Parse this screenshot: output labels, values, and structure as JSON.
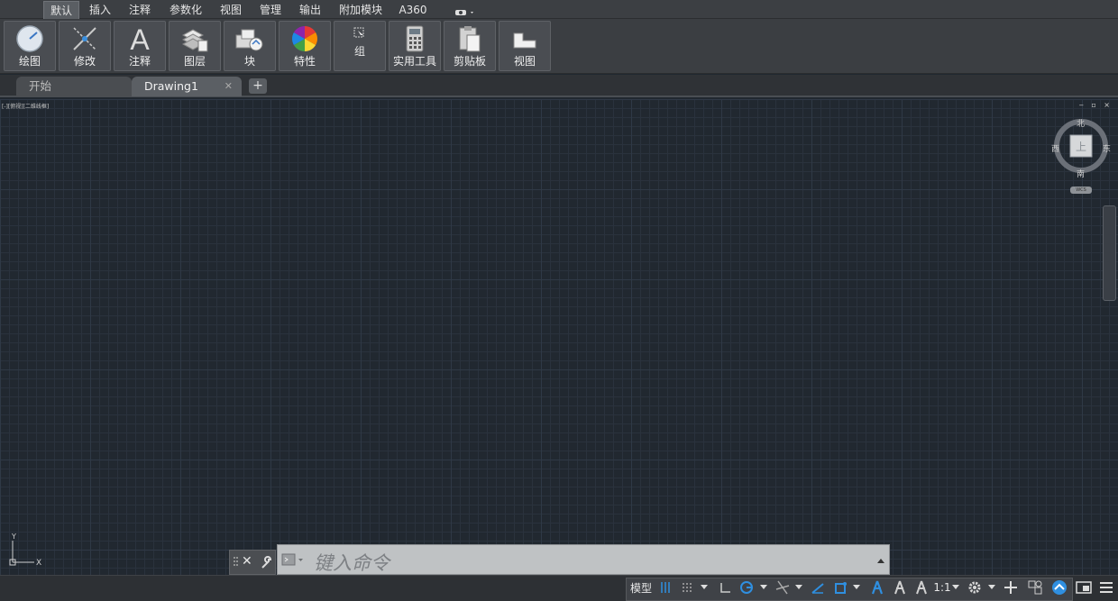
{
  "menu": {
    "tabs": [
      "默认",
      "插入",
      "注释",
      "参数化",
      "视图",
      "管理",
      "输出",
      "附加模块",
      "A360"
    ],
    "active_tab": "默认"
  },
  "ribbon": {
    "buttons": [
      {
        "label": "绘图",
        "icon": "draw-icon"
      },
      {
        "label": "修改",
        "icon": "modify-icon"
      },
      {
        "label": "注释",
        "icon": "annotation-icon"
      },
      {
        "label": "图层",
        "icon": "layers-icon"
      },
      {
        "label": "块",
        "icon": "block-icon"
      },
      {
        "label": "特性",
        "icon": "properties-icon"
      },
      {
        "label": "组",
        "icon": "group-icon"
      },
      {
        "label": "实用工具",
        "icon": "calculator-icon"
      },
      {
        "label": "剪贴板",
        "icon": "clipboard-icon"
      },
      {
        "label": "视图",
        "icon": "view-icon"
      }
    ]
  },
  "file_tabs": {
    "start_label": "开始",
    "drawing_label": "Drawing1",
    "close_glyph": "✕",
    "add_glyph": "+"
  },
  "viewport": {
    "view_label": "[-][俯视][二维线框]",
    "window_controls": "‒ ▫ ×"
  },
  "viewcube": {
    "north": "北",
    "south": "南",
    "east": "东",
    "west": "西",
    "wcs_label": "WCS"
  },
  "ucs": {
    "x_label": "X",
    "y_label": "Y"
  },
  "command_line": {
    "placeholder": "键入命令",
    "close_glyph": "✕"
  },
  "status_bar": {
    "model_label": "模型",
    "scale_label": "1:1"
  },
  "colors": {
    "canvas_bg": "#212830",
    "accent_blue": "#2f8fe0"
  }
}
